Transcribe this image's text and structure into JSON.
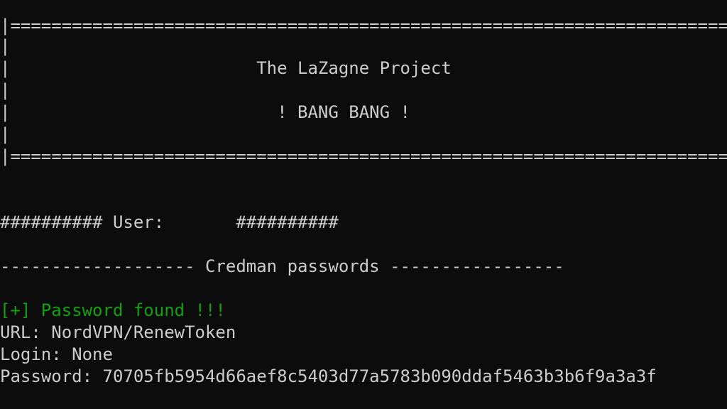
{
  "banner": {
    "border_top": "|====================================================================================",
    "pipe_1": "|",
    "title": "|                        The LaZagne Project",
    "pipe_2": "|",
    "subtitle": "|                          ! BANG BANG !",
    "pipe_3": "|",
    "border_bottom": "|===================================================================================="
  },
  "user_header": "########## User:       ##########",
  "section_header": "------------------- Credman passwords -----------------",
  "result": {
    "found": "[+] Password found !!!",
    "url": "URL: NordVPN/RenewToken",
    "login": "Login: None",
    "password": "Password: 70705fb5954d66aef8c5403d77a5783b090ddaf5463b3b6f9a3a3f"
  },
  "colors": {
    "background": "#0c0c0c",
    "text": "#cccccc",
    "success": "#13a10e"
  }
}
